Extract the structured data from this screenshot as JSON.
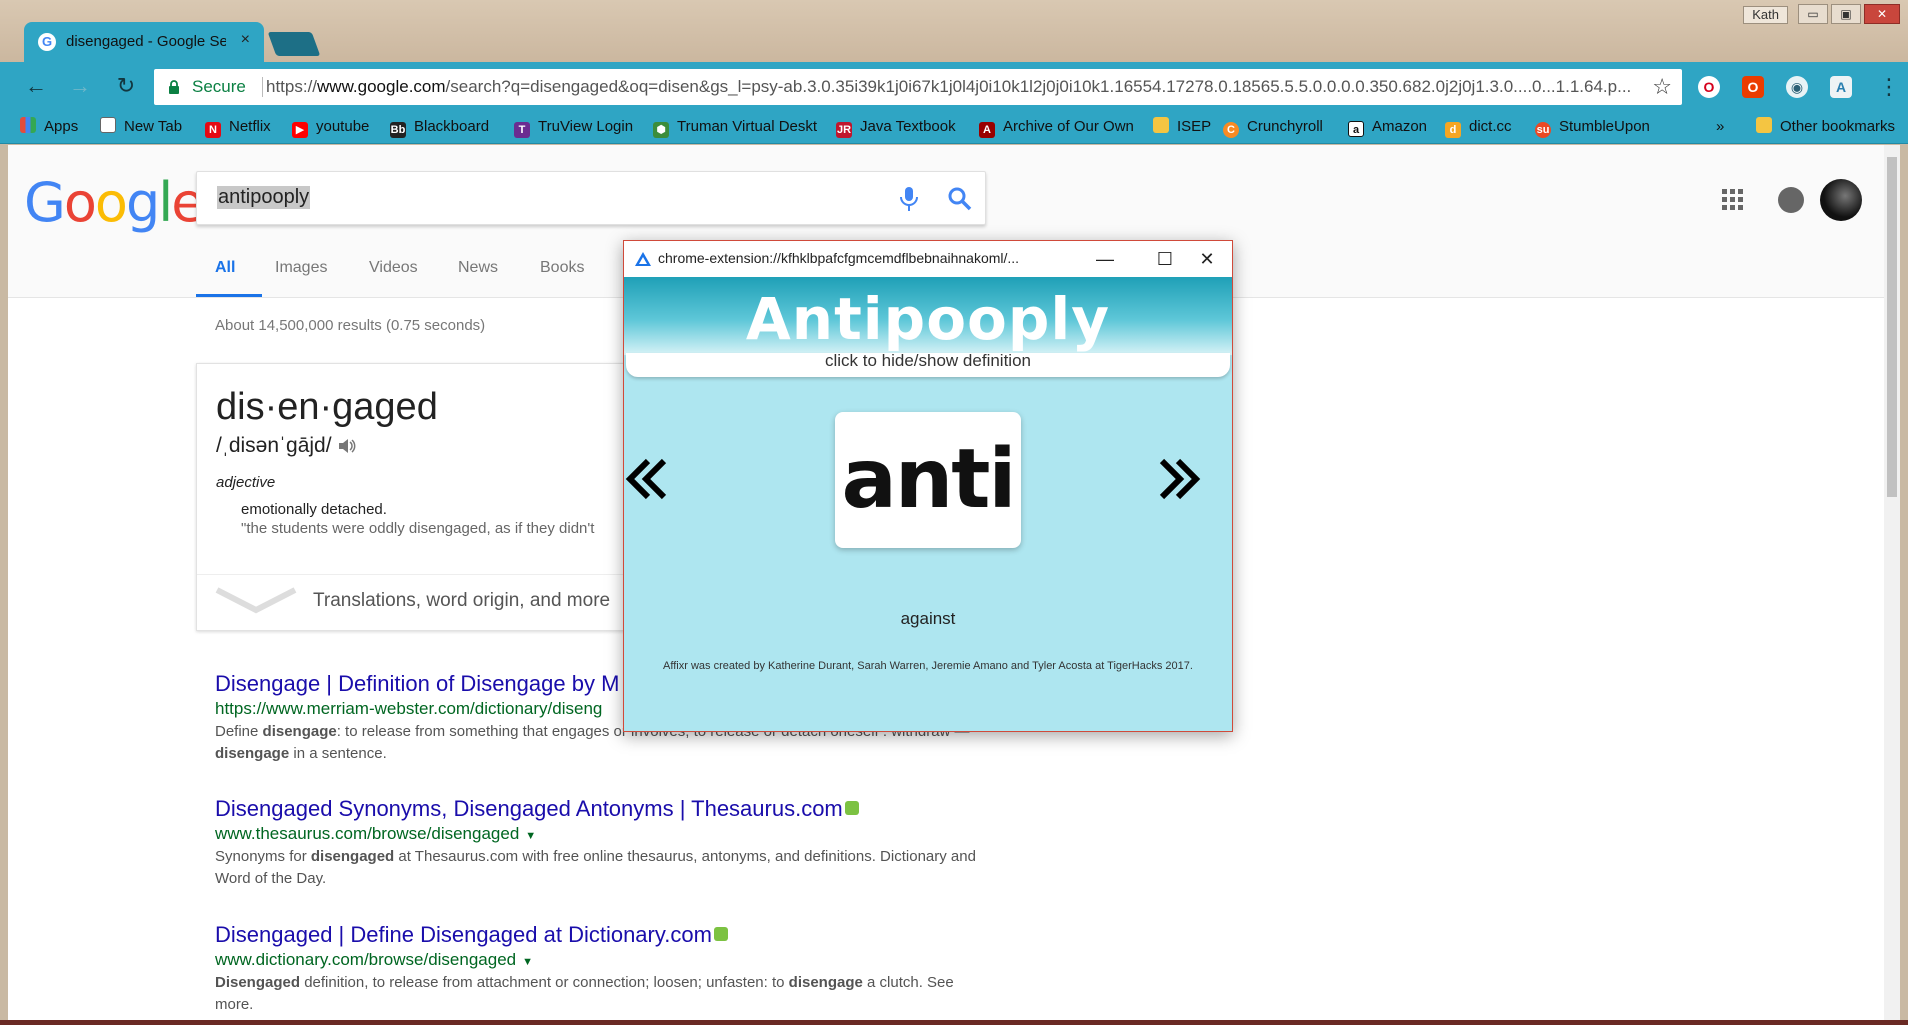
{
  "browser": {
    "user_label": "Kath",
    "window_controls": {
      "min": "▭",
      "max": "▣",
      "close": "✕"
    },
    "active_tab": {
      "title": "disengaged - Google Se",
      "favicon": "G",
      "close": "×"
    },
    "nav": {
      "back": "←",
      "forward": "→",
      "reload": "↻",
      "menu": "⋮"
    },
    "omnibox": {
      "secure_label": "Secure",
      "url_scheme": "https://",
      "url_host": "www.google.com",
      "url_rest": "/search?q=disengaged&oq=disen&gs_l=psy-ab.3.0.35i39k1j0i67k1j0l4j0i10k1l2j0j0i10k1.16554.17278.0.18565.5.5.0.0.0.0.350.682.0j2j0j1.3.0....0...1.1.64.p...",
      "star": "☆"
    },
    "extensions": {
      "opera": "O",
      "office": "O",
      "eye": "◉",
      "affixr": "A"
    },
    "bookmarks": [
      {
        "label": "Apps",
        "icon": "apps-grid-icon",
        "color": "#e44c3c"
      },
      {
        "label": "New Tab",
        "icon": "page-icon",
        "color": "#ffffff"
      },
      {
        "label": "Netflix",
        "icon": "netflix-icon",
        "color": "#e50914"
      },
      {
        "label": "youtube",
        "icon": "youtube-icon",
        "color": "#ff0000"
      },
      {
        "label": "Blackboard",
        "icon": "blackboard-icon",
        "color": "#222222"
      },
      {
        "label": "TruView Login",
        "icon": "truview-icon",
        "color": "#6b2c91"
      },
      {
        "label": "Truman Virtual Deskt",
        "icon": "network-icon",
        "color": "#3c8d3c"
      },
      {
        "label": "Java Textbook",
        "icon": "textbook-icon",
        "color": "#c0162d"
      },
      {
        "label": "Archive of Our Own",
        "icon": "ao3-icon",
        "color": "#990000"
      },
      {
        "label": "ISEP",
        "icon": "folder-icon",
        "color": "#f4c542"
      },
      {
        "label": "Crunchyroll",
        "icon": "crunchyroll-icon",
        "color": "#f78b24"
      },
      {
        "label": "Amazon",
        "icon": "amazon-icon",
        "color": "#111111"
      },
      {
        "label": "dict.cc",
        "icon": "dictcc-icon",
        "color": "#f5a623"
      },
      {
        "label": "StumbleUpon",
        "icon": "stumbleupon-icon",
        "color": "#eb4924"
      }
    ],
    "bookmarks_overflow": "»",
    "other_bookmarks": "Other bookmarks"
  },
  "google": {
    "logo": [
      "G",
      "o",
      "o",
      "g",
      "l",
      "e"
    ],
    "logo_colors": [
      "#4285f4",
      "#ea4335",
      "#fbbc05",
      "#4285f4",
      "#34a853",
      "#ea4335"
    ],
    "query": "antipooply",
    "tabs": [
      "All",
      "Images",
      "Videos",
      "News",
      "Books"
    ],
    "result_stats": "About 14,500,000 results (0.75 seconds)",
    "notification_count": "",
    "dictionary": {
      "word": "dis·en·gaged",
      "pronunciation": "/ˌdisənˈɡājd/",
      "part_of_speech": "adjective",
      "definition": "emotionally detached.",
      "example": "\"the students were oddly disengaged, as if they didn't",
      "more_label": "Translations, word origin, and more"
    },
    "results": [
      {
        "title": "Disengage | Definition of Disengage by M",
        "url": "https://www.merriam-webster.com/dictionary/diseng",
        "snippet_parts": [
          "Define ",
          "disengage",
          ": to release from something that engages or involves; to release or detach oneself : withdraw — ",
          "disengage",
          " in a sentence."
        ]
      },
      {
        "title": "Disengaged Synonyms, Disengaged Antonyms | Thesaurus.com",
        "url": "www.thesaurus.com/browse/disengaged",
        "snippet_parts": [
          "Synonyms for ",
          "disengaged",
          " at Thesaurus.com with free online thesaurus, antonyms, and definitions. Dictionary and Word of the Day."
        ]
      },
      {
        "title": "Disengaged | Define Disengaged at Dictionary.com",
        "url": "www.dictionary.com/browse/disengaged",
        "snippet_parts": [
          "Disengaged",
          " definition, to release from attachment or connection; loosen; unfasten: to ",
          "disengage",
          " a clutch. See more."
        ]
      }
    ]
  },
  "popup": {
    "title": "chrome-extension://kfhklbpafcfgmcemdflbebnaihnakoml/...",
    "controls": {
      "min": "—",
      "max": "☐",
      "close": "✕"
    },
    "heading": "Antipooply",
    "toggle_label": "click to hide/show definition",
    "affix": "anti",
    "meaning": "against",
    "credits": "Affixr was created by Katherine Durant, Sarah Warren, Jeremie Amano and Tyler Acosta at TigerHacks 2017.",
    "colors": {
      "accent": "#1fa0b7",
      "background": "#aee6f0",
      "border": "#d04a3a"
    }
  }
}
